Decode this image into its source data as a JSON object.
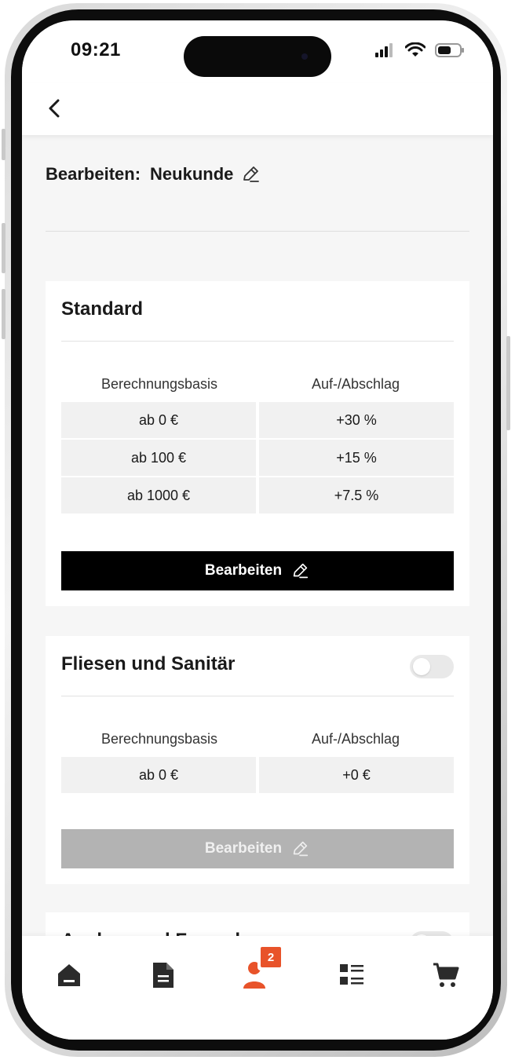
{
  "status": {
    "time": "09:21"
  },
  "page": {
    "edit_prefix": "Bearbeiten:",
    "edit_name": "Neukunde"
  },
  "cards": [
    {
      "title": "Standard",
      "has_toggle": false,
      "headers": [
        "Berechnungsbasis",
        "Auf-/Abschlag"
      ],
      "rows": [
        [
          "ab 0 €",
          "+30 %"
        ],
        [
          "ab 100 €",
          "+15 %"
        ],
        [
          "ab 1000 €",
          "+7.5 %"
        ]
      ],
      "button": "Bearbeiten",
      "button_enabled": true
    },
    {
      "title": "Fliesen und Sanitär",
      "has_toggle": true,
      "toggle_on": false,
      "headers": [
        "Berechnungsbasis",
        "Auf-/Abschlag"
      ],
      "rows": [
        [
          "ab 0 €",
          "+0 €"
        ]
      ],
      "button": "Bearbeiten",
      "button_enabled": false
    },
    {
      "title": "Ausbau und Fassade",
      "has_toggle": true,
      "toggle_on": false
    }
  ],
  "tabbar": {
    "items": [
      {
        "icon": "home-icon"
      },
      {
        "icon": "document-icon"
      },
      {
        "icon": "customer-icon",
        "badge": "2",
        "active": true
      },
      {
        "icon": "list-icon"
      },
      {
        "icon": "cart-icon"
      }
    ]
  },
  "colors": {
    "accent": "#e8532a",
    "icon": "#2b2b2b",
    "primary_button": "#000000",
    "disabled_button": "#b3b3b3"
  }
}
